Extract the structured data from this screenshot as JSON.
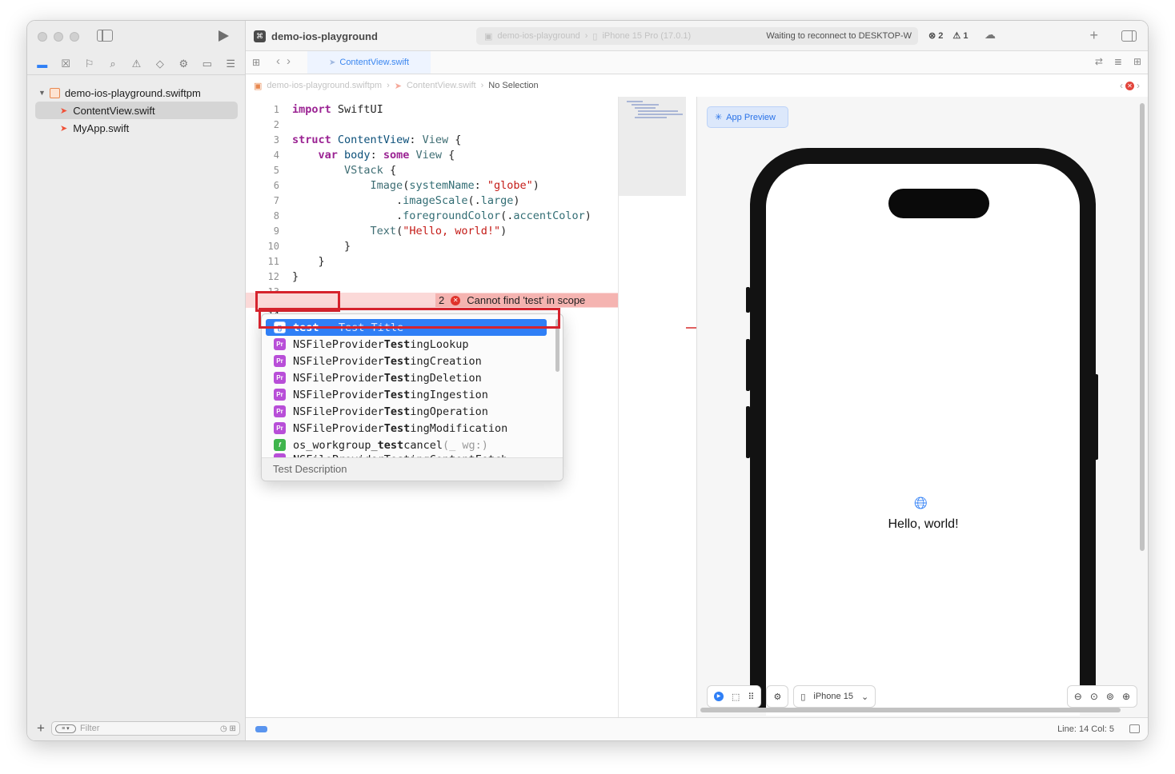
{
  "window": {
    "project_name": "demo-ios-playground",
    "scheme_target": "demo-ios-playground",
    "scheme_device": "iPhone 15 Pro (17.0.1)",
    "status_text": "Waiting to reconnect to DESKTOP-W",
    "error_count": "2",
    "warning_count": "1"
  },
  "sidebar": {
    "package_name": "demo-ios-playground.swiftpm",
    "files": [
      "ContentView.swift",
      "MyApp.swift"
    ],
    "filter_placeholder": "Filter"
  },
  "editor": {
    "active_tab": "ContentView.swift",
    "jumpbar": [
      "demo-ios-playground.swiftpm",
      "ContentView.swift",
      "No Selection"
    ],
    "error_message": "Cannot find 'test' in scope",
    "error_badge_count": "2",
    "lines": {
      "n1": "1",
      "n2": "2",
      "n3": "3",
      "n4": "4",
      "n5": "5",
      "n6": "6",
      "n7": "7",
      "n8": "8",
      "n9": "9",
      "n10": "10",
      "n11": "11",
      "n12": "12",
      "n13": "13",
      "n14": "14"
    }
  },
  "completion": {
    "selected_keyword": "test",
    "selected_title": " – Test Title",
    "items": [
      {
        "badge": "Pr",
        "prefix": "NSFileProvider",
        "match": "Test",
        "suffix": "ingLookup"
      },
      {
        "badge": "Pr",
        "prefix": "NSFileProvider",
        "match": "Test",
        "suffix": "ingCreation"
      },
      {
        "badge": "Pr",
        "prefix": "NSFileProvider",
        "match": "Test",
        "suffix": "ingDeletion"
      },
      {
        "badge": "Pr",
        "prefix": "NSFileProvider",
        "match": "Test",
        "suffix": "ingIngestion"
      },
      {
        "badge": "Pr",
        "prefix": "NSFileProvider",
        "match": "Test",
        "suffix": "ingOperation"
      },
      {
        "badge": "Pr",
        "prefix": "NSFileProvider",
        "match": "Test",
        "suffix": "ingModification"
      }
    ],
    "func_item": {
      "badge": "f",
      "prefix": "os_workgroup_",
      "match": "test",
      "suffix": "cancel",
      "args": "(_ wg:)"
    },
    "partial_item": "NSFileProviderTestingContentFetch",
    "description": "Test Description"
  },
  "preview": {
    "app_preview_label": "App Preview",
    "hello_text": "Hello, world!",
    "device_label": "iPhone 15"
  },
  "status": {
    "position": "Line: 14  Col: 5"
  }
}
